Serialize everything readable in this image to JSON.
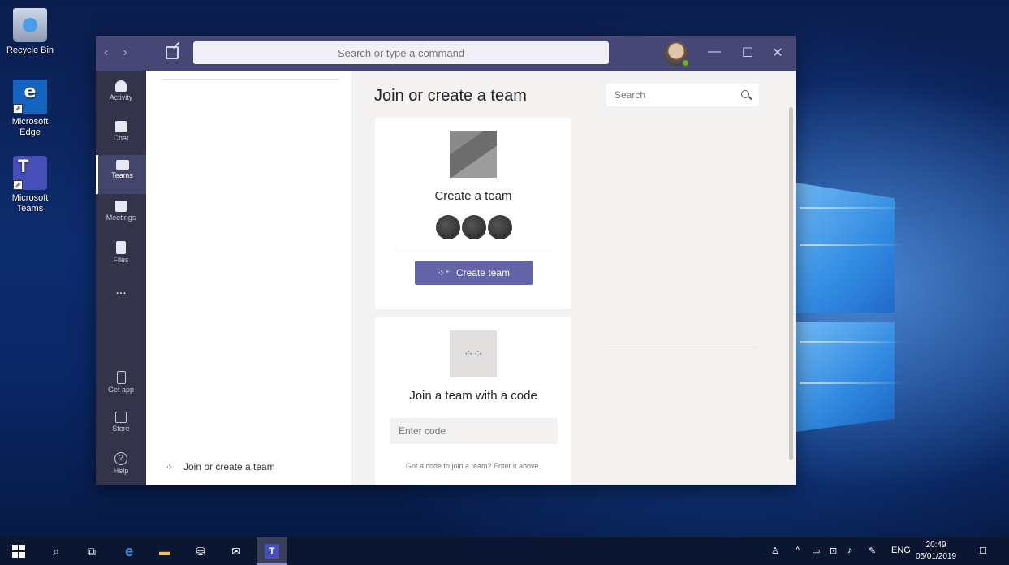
{
  "desktop": {
    "icons": [
      {
        "label": "Recycle Bin"
      },
      {
        "label": "Microsoft Edge"
      },
      {
        "label": "Microsoft Teams"
      }
    ]
  },
  "titlebar": {
    "search_placeholder": "Search or type a command",
    "nav_back": "‹",
    "nav_forward": "›",
    "minimize": "—",
    "maximize": "☐",
    "close": "✕"
  },
  "rail": {
    "items": [
      {
        "label": "Activity"
      },
      {
        "label": "Chat"
      },
      {
        "label": "Teams"
      },
      {
        "label": "Meetings"
      },
      {
        "label": "Files"
      },
      {
        "label": "..."
      },
      {
        "label": "Get app"
      },
      {
        "label": "Store"
      },
      {
        "label": "Help"
      }
    ]
  },
  "list_pane": {
    "join_label": "Join or create a team"
  },
  "main": {
    "title": "Join or create a team",
    "search_placeholder": "Search",
    "create_card": {
      "title": "Create a team",
      "button_label": "Create team"
    },
    "code_card": {
      "title": "Join a team with a code",
      "input_placeholder": "Enter code",
      "hint": "Got a code to join a team? Enter it above."
    }
  },
  "taskbar": {
    "language": "ENG",
    "time": "20:49",
    "date": "05/01/2019"
  },
  "colors": {
    "titlebar": "#464775",
    "rail": "#33344a",
    "accent": "#6264a7"
  }
}
